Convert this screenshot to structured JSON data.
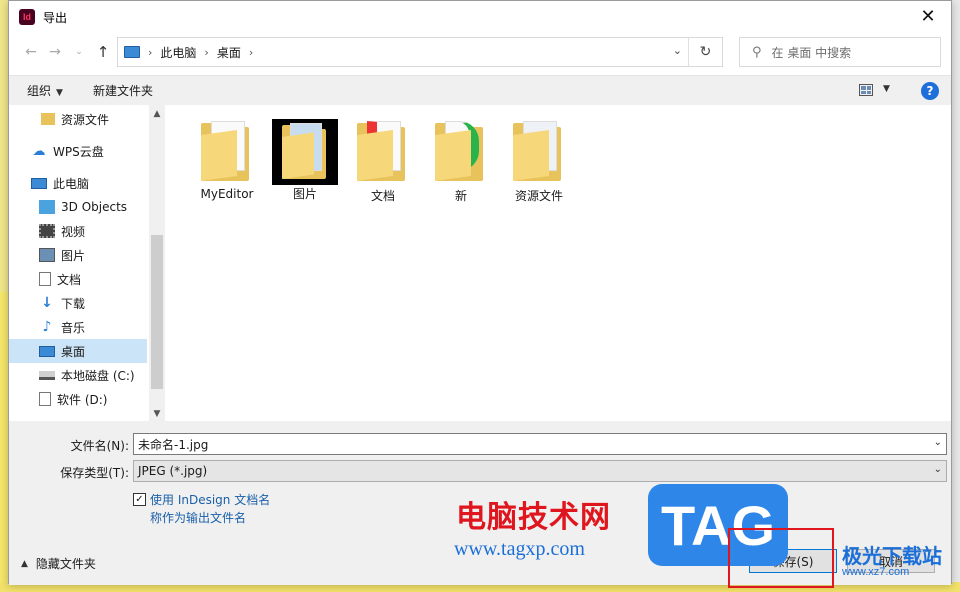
{
  "window": {
    "title": "导出",
    "app_icon_text": "Id"
  },
  "address": {
    "segments": [
      "此电脑",
      "桌面"
    ]
  },
  "search": {
    "placeholder": "在 桌面 中搜索"
  },
  "toolbar": {
    "organize": "组织",
    "new_folder": "新建文件夹"
  },
  "sidebar": {
    "items": [
      {
        "label": "资源文件",
        "icon": "folder-icon"
      },
      {
        "label": "WPS云盘",
        "icon": "cloud-icon"
      },
      {
        "label": "此电脑",
        "icon": "computer-icon"
      },
      {
        "label": "3D Objects",
        "icon": "cube-icon"
      },
      {
        "label": "视频",
        "icon": "video-icon"
      },
      {
        "label": "图片",
        "icon": "pictures-icon"
      },
      {
        "label": "文档",
        "icon": "document-icon"
      },
      {
        "label": "下载",
        "icon": "download-icon"
      },
      {
        "label": "音乐",
        "icon": "music-icon"
      },
      {
        "label": "桌面",
        "icon": "desktop-icon",
        "selected": true
      },
      {
        "label": "本地磁盘 (C:)",
        "icon": "drive-icon"
      },
      {
        "label": "软件 (D:)",
        "icon": "drive-icon"
      }
    ]
  },
  "files": [
    {
      "label": "MyEditor",
      "icon": "folder-icon"
    },
    {
      "label": "图片",
      "icon": "folder-icon"
    },
    {
      "label": "文档",
      "icon": "folder-icon"
    },
    {
      "label": "新",
      "icon": "folder-icon"
    },
    {
      "label": "资源文件",
      "icon": "folder-icon"
    }
  ],
  "form": {
    "filename_label": "文件名(N):",
    "filename_value": "未命名-1.jpg",
    "type_label": "保存类型(T):",
    "type_value": "JPEG (*.jpg)",
    "checkbox_checked": true,
    "checkbox_line1": "使用 InDesign 文档名",
    "checkbox_line2": "称作为输出文件名"
  },
  "footer": {
    "hide_folders": "隐藏文件夹",
    "save": "保存(S)",
    "cancel": "取消"
  },
  "watermark": {
    "site_cn": "电脑技术网",
    "site_url": "www.tagxp.com",
    "tag": "TAG",
    "site2": "极光下载站",
    "site2_url": "www.xz7.com"
  },
  "colors": {
    "accent": "#0078d7",
    "selected_bg": "#cce4f7",
    "folder": "#e8c25a"
  }
}
